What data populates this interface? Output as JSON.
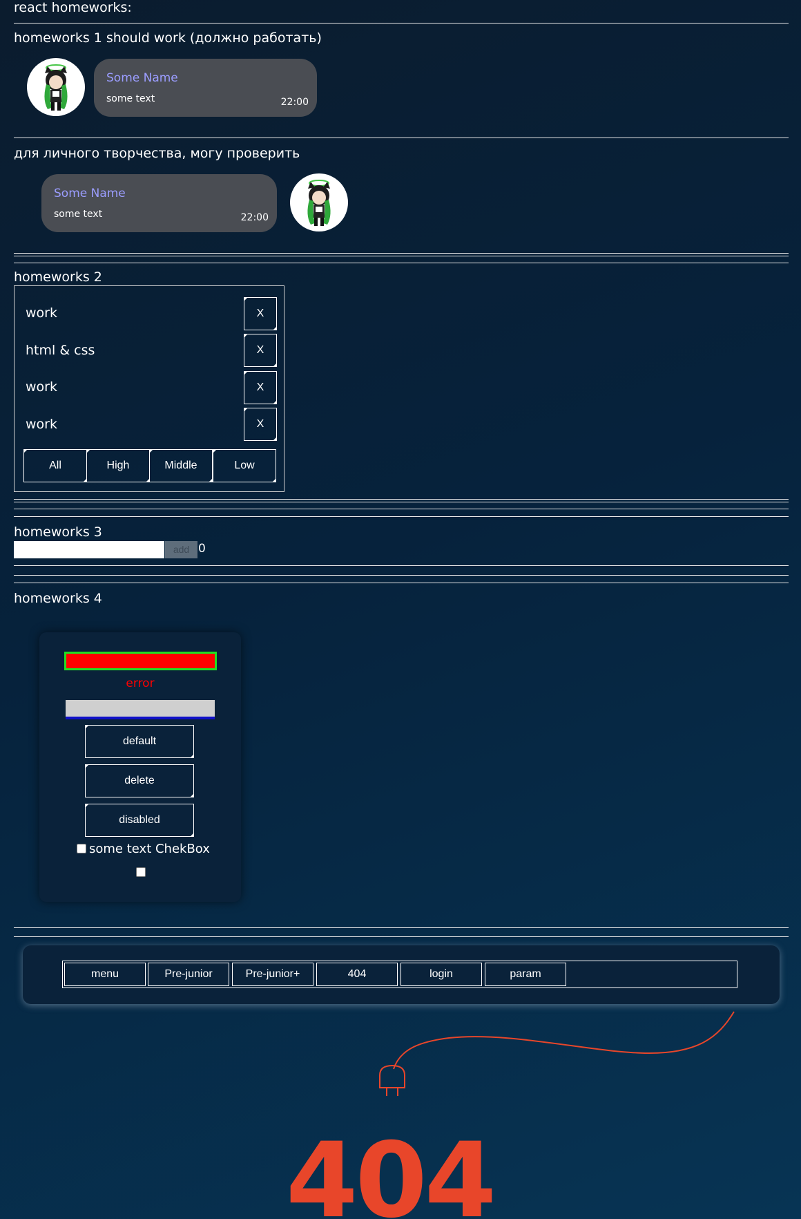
{
  "page": {
    "title": "react homeworks:"
  },
  "hw1": {
    "title": "homeworks 1 should work (должно работать)",
    "message": {
      "name": "Some Name",
      "text": "some text",
      "time": "22:00"
    },
    "creative_title": "для личного творчества, могу проверить",
    "friend_message": {
      "name": "Some Name",
      "text": "some text",
      "time": "22:00"
    }
  },
  "hw2": {
    "title": "homeworks 2",
    "affairs": [
      {
        "name": "work",
        "delete_label": "X"
      },
      {
        "name": "html & css",
        "delete_label": "X"
      },
      {
        "name": "work",
        "delete_label": "X"
      },
      {
        "name": "work",
        "delete_label": "X"
      }
    ],
    "filters": [
      "All",
      "High",
      "Middle",
      "Low"
    ]
  },
  "hw3": {
    "title": "homeworks 3",
    "input_value": "",
    "add_label": "add",
    "count": "0"
  },
  "hw4": {
    "title": "homeworks 4",
    "error_text": "error",
    "buttons": [
      "default",
      "delete",
      "disabled"
    ],
    "checkbox_label": "some text ChekBox"
  },
  "nav": {
    "items": [
      "menu",
      "Pre-junior",
      "Pre-junior+",
      "404",
      "login",
      "param"
    ]
  },
  "error_page": {
    "code": "404"
  },
  "colors": {
    "accent_name": "#9b9dff",
    "bubble": "#4a4d53",
    "error": "#ff0000",
    "input_error_border": "#22dd22",
    "plug": "#e8462a"
  }
}
